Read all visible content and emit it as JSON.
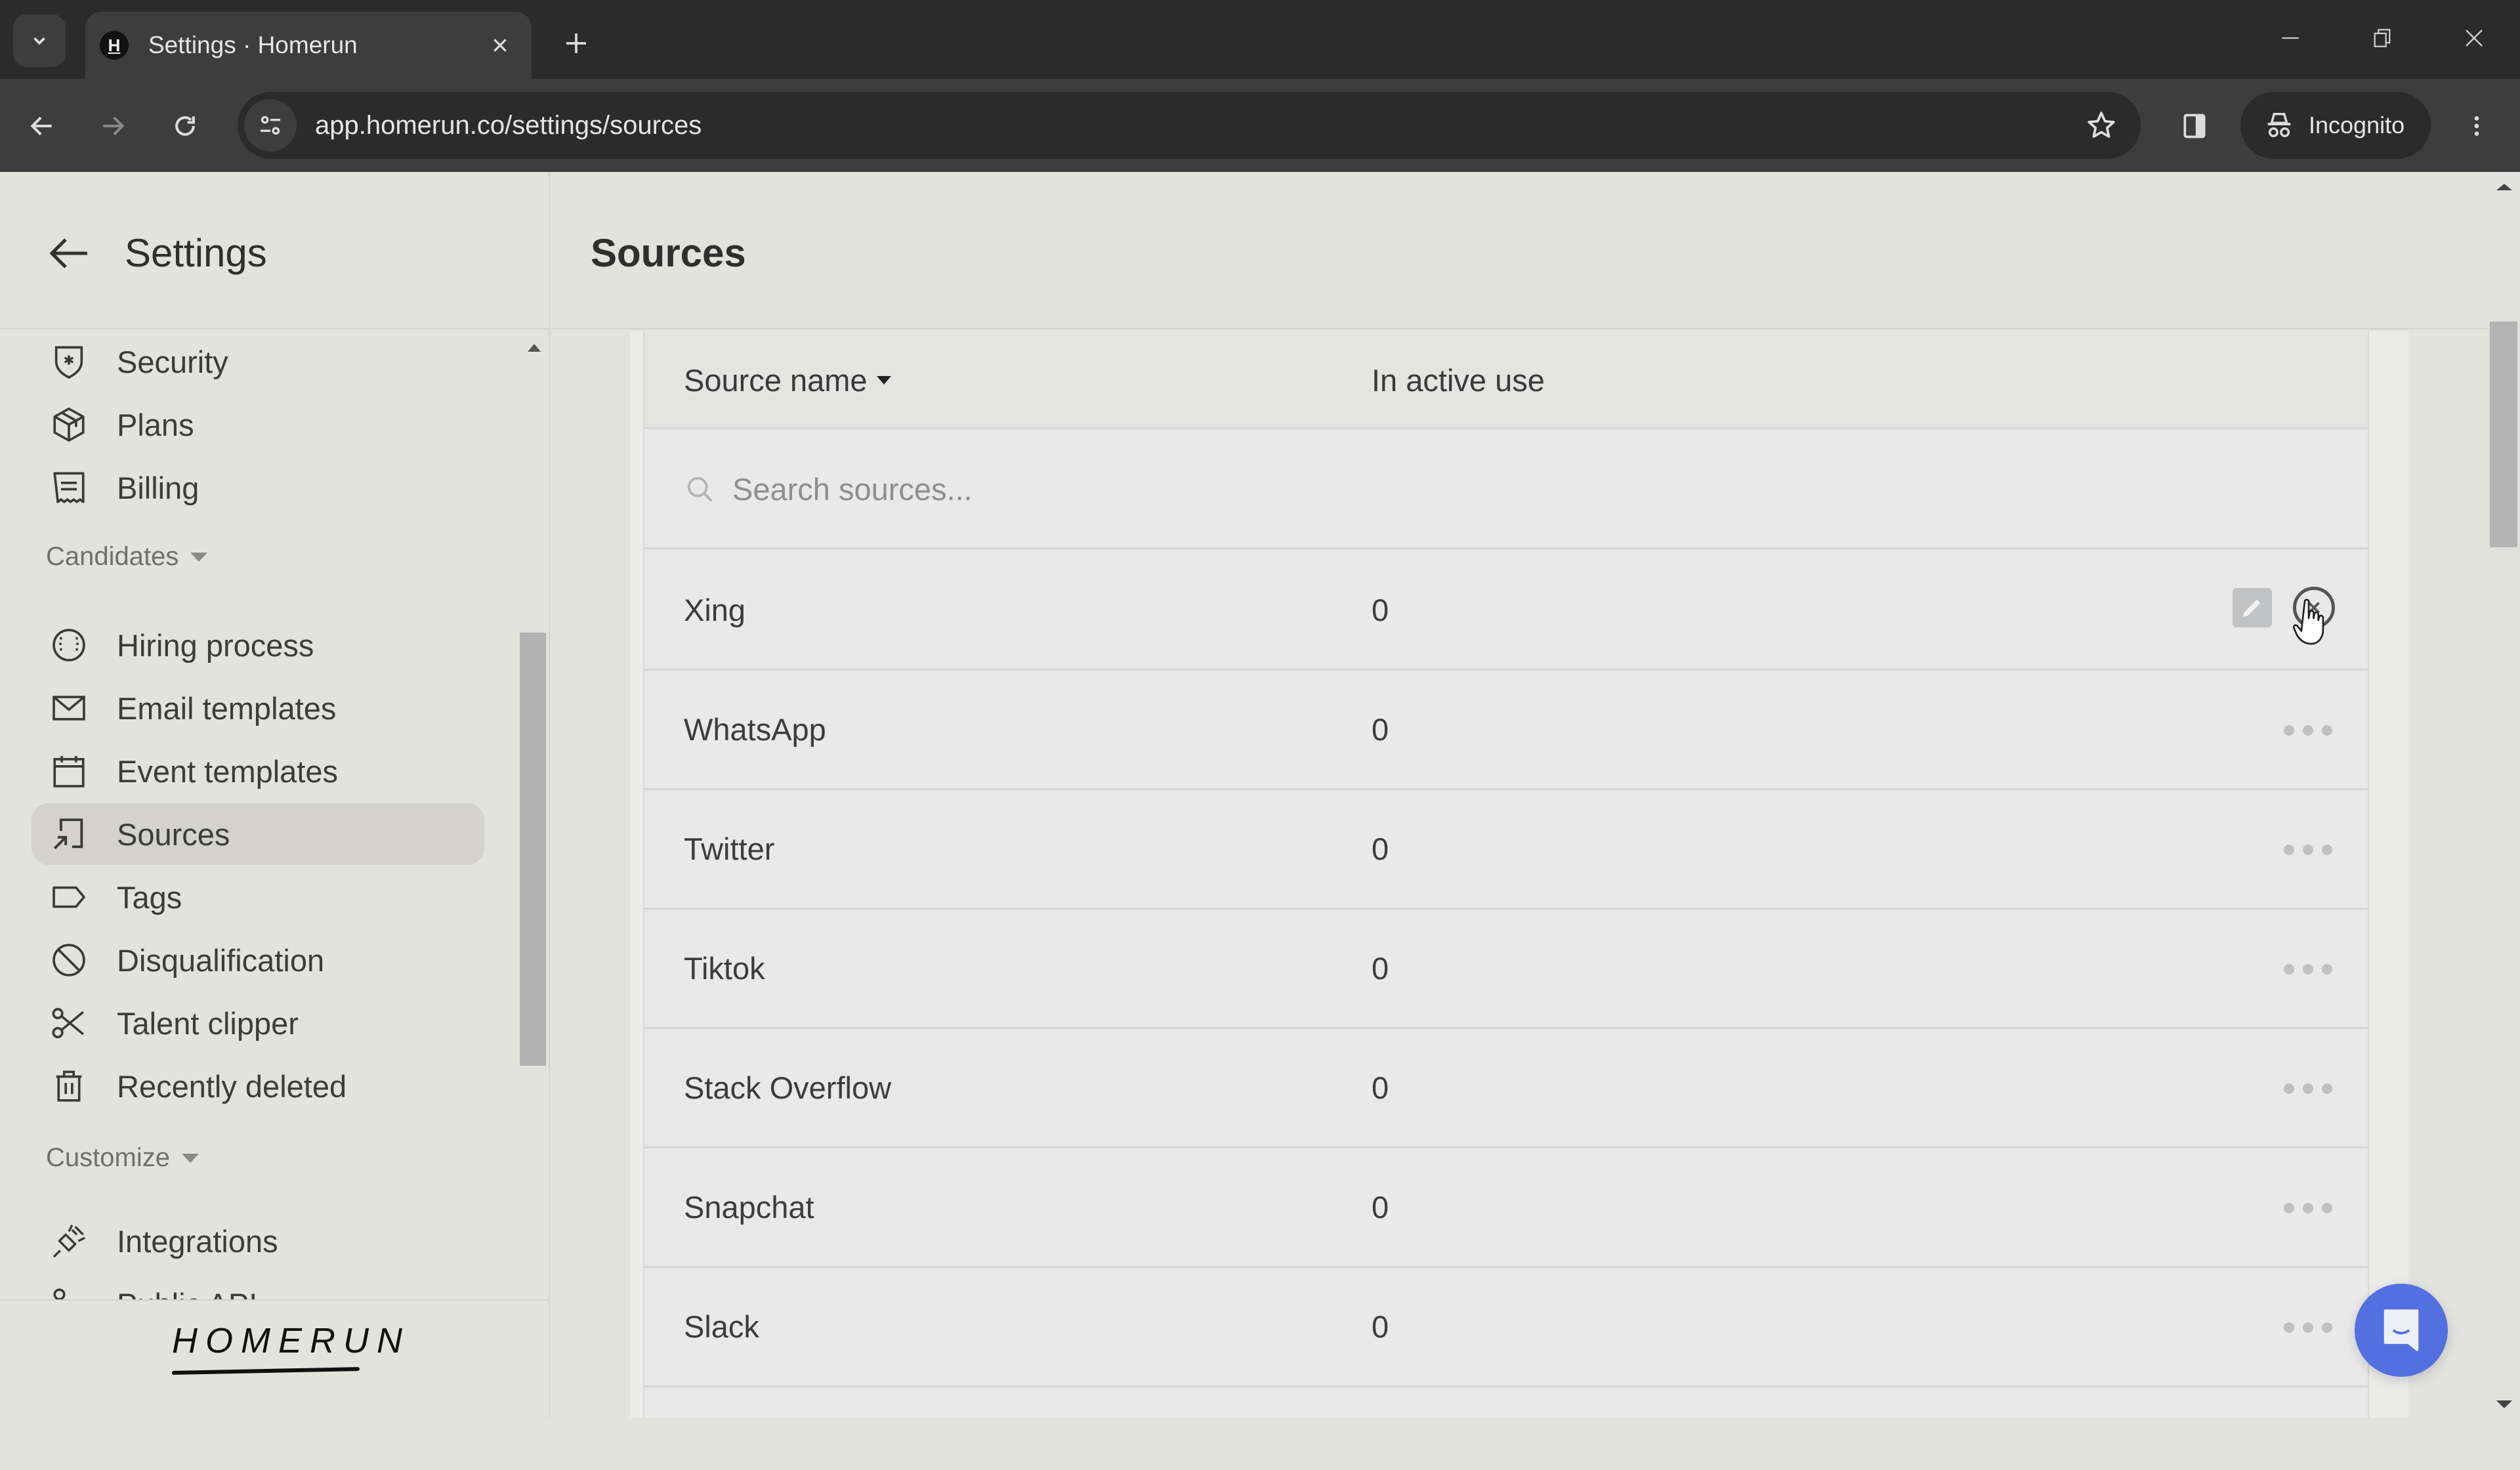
{
  "browser": {
    "tab_title": "Settings · Homerun",
    "favicon_letter": "H",
    "url": "app.homerun.co/settings/sources",
    "incognito_label": "Incognito"
  },
  "sidebar": {
    "title": "Settings",
    "top_items": [
      {
        "label": "Security",
        "icon": "shield-star-icon"
      },
      {
        "label": "Plans",
        "icon": "package-icon"
      },
      {
        "label": "Billing",
        "icon": "receipt-icon"
      }
    ],
    "sections": [
      {
        "title": "Candidates",
        "items": [
          {
            "label": "Hiring process",
            "icon": "baseball-icon"
          },
          {
            "label": "Email templates",
            "icon": "envelope-icon"
          },
          {
            "label": "Event templates",
            "icon": "calendar-icon"
          },
          {
            "label": "Sources",
            "icon": "sources-arrow-icon",
            "active": true
          },
          {
            "label": "Tags",
            "icon": "tag-icon"
          },
          {
            "label": "Disqualification",
            "icon": "prohibited-icon"
          },
          {
            "label": "Talent clipper",
            "icon": "scissors-icon"
          },
          {
            "label": "Recently deleted",
            "icon": "trash-icon"
          }
        ]
      },
      {
        "title": "Customize",
        "items": [
          {
            "label": "Integrations",
            "icon": "plug-icon"
          },
          {
            "label": "Public API",
            "icon": "api-icon"
          }
        ]
      }
    ],
    "logo_text": "HOMERUN"
  },
  "main": {
    "title": "Sources",
    "table": {
      "columns": [
        "Source name",
        "In active use"
      ],
      "sorted_column": "Source name",
      "search_placeholder": "Search sources...",
      "search_value": "",
      "rows": [
        {
          "name": "Xing",
          "count": "0",
          "hovered": true
        },
        {
          "name": "WhatsApp",
          "count": "0"
        },
        {
          "name": "Twitter",
          "count": "0"
        },
        {
          "name": "Tiktok",
          "count": "0"
        },
        {
          "name": "Stack Overflow",
          "count": "0"
        },
        {
          "name": "Snapchat",
          "count": "0"
        },
        {
          "name": "Slack",
          "count": "0"
        }
      ]
    }
  },
  "colors": {
    "chat_button": "#5470e0",
    "active_item_bg": "#d3d2ce",
    "chrome_bg": "#2b2b2b"
  }
}
